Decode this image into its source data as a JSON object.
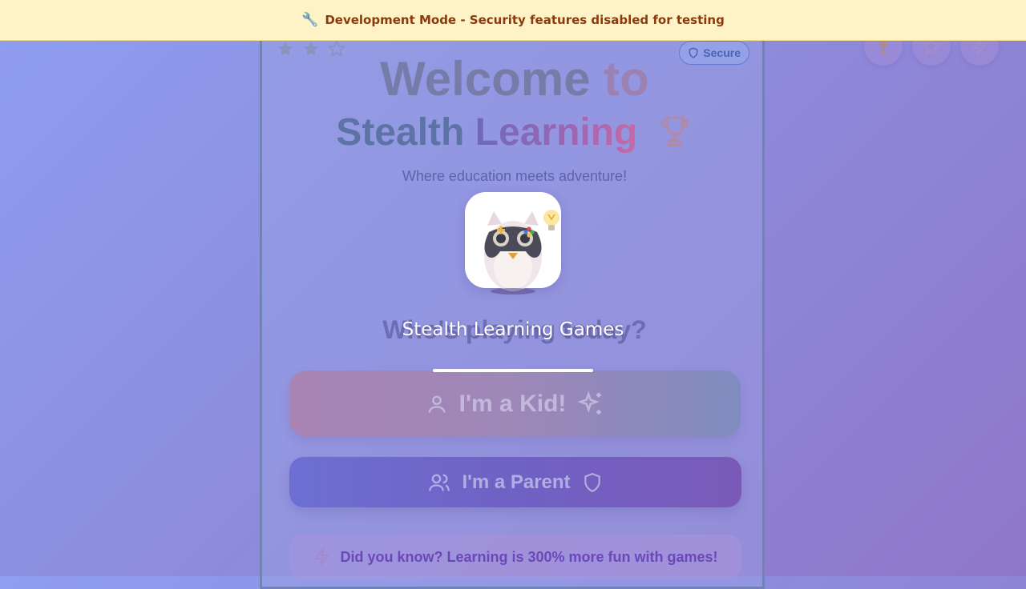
{
  "dev_banner": {
    "icon": "wrench-icon",
    "text": "Development Mode - Security features disabled for testing"
  },
  "corner_buttons": [
    {
      "icon": "trophy-icon"
    },
    {
      "icon": "star-icon"
    },
    {
      "icon": "zap-icon"
    }
  ],
  "card": {
    "stars": {
      "filled": 2,
      "total": 3
    },
    "secure_badge": {
      "icon": "shield-icon",
      "label": "Secure"
    },
    "title_line1_a": "Welcome",
    "title_line1_b": "to",
    "title_line2_a": "Stealth",
    "title_line2_b": "Learning",
    "title_icon": "trophy-icon",
    "tagline": "Where education meets adventure!",
    "who_heading": "Who's playing today?",
    "kid_button": {
      "label": "I'm a Kid!",
      "left_icon": "user-icon",
      "right_icon": "sparkles-icon"
    },
    "parent_button": {
      "label": "I'm a Parent",
      "left_icon": "users-icon",
      "right_icon": "shield-icon"
    },
    "fact": {
      "icon": "zap-icon",
      "text": "Did you know? Learning is 300% more fun with games!"
    }
  },
  "splash": {
    "logo": "owl-gamepad-logo",
    "title": "Stealth Learning Games",
    "progress": 1.0
  },
  "colors": {
    "dev_banner_bg": "#fef3c7",
    "dev_banner_text": "#8a3a0e",
    "accent_purple": "#7a5ab8",
    "accent_blue": "#6d6fd2"
  }
}
